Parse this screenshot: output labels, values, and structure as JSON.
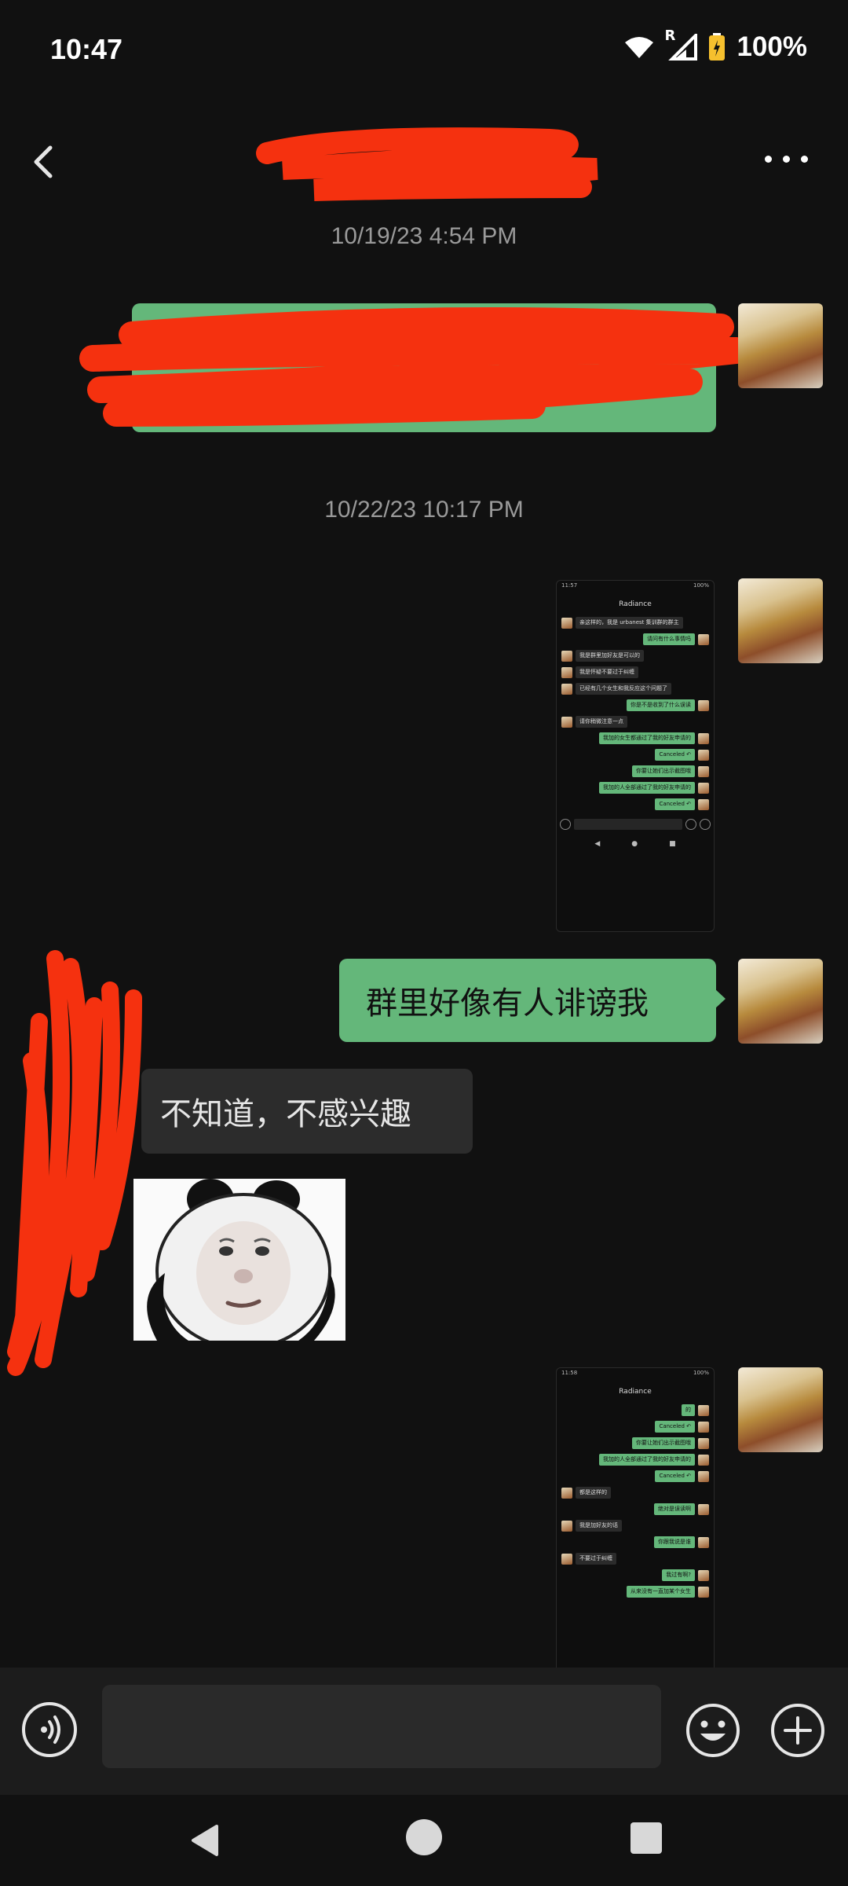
{
  "status_bar": {
    "time": "10:47",
    "signal_label": "R",
    "battery": "100%"
  },
  "header": {
    "back_icon": "chevron-left-icon",
    "more_icon": "more-dots-icon",
    "title_redacted": true
  },
  "messages": [
    {
      "type": "timestamp",
      "text": "10/19/23 4:54 PM"
    },
    {
      "type": "outgoing-text",
      "redacted": true
    },
    {
      "type": "timestamp",
      "text": "10/22/23 10:17 PM"
    },
    {
      "type": "outgoing-image",
      "screenshot": {
        "status_time": "11:57",
        "status_right": "100%",
        "title": "Radiance",
        "rows": [
          {
            "side": "in",
            "text": "亲这样的，我是 urbanest 集训群的群主"
          },
          {
            "side": "out",
            "text": "请问有什么事情吗"
          },
          {
            "side": "in",
            "text": "我是群里加好友是可以的"
          },
          {
            "side": "in",
            "text": "我是怀疑不要过于纠缠"
          },
          {
            "side": "in",
            "text": "已经有几个女生和我反应这个问题了"
          },
          {
            "side": "out",
            "text": "你是不是收到了什么误读"
          },
          {
            "side": "in",
            "text": "请你稍微注意一点"
          },
          {
            "side": "out",
            "text": "我加的女生都通过了我的好友申请的"
          },
          {
            "side": "out",
            "text": "Canceled ↶"
          },
          {
            "side": "out",
            "text": "你要让她们出示截图哦"
          },
          {
            "side": "out",
            "text": "我加的人全部通过了我的好友申请的"
          },
          {
            "side": "out",
            "text": "Canceled ↶"
          }
        ]
      }
    },
    {
      "type": "outgoing-text",
      "text": "群里好像有人诽谤我"
    },
    {
      "type": "incoming-text",
      "text": "不知道，不感兴趣"
    },
    {
      "type": "incoming-sticker",
      "sticker": "panda-face-sticker"
    },
    {
      "type": "outgoing-image",
      "screenshot": {
        "status_time": "11:58",
        "status_right": "100%",
        "title": "Radiance",
        "rows": [
          {
            "side": "out",
            "text": "的"
          },
          {
            "side": "out",
            "text": "Canceled ↶"
          },
          {
            "side": "out",
            "text": "你要让她们出示截图哦"
          },
          {
            "side": "out",
            "text": "我加的人全部通过了我的好友申请的"
          },
          {
            "side": "out",
            "text": "Canceled ↶"
          },
          {
            "side": "in",
            "text": "都是这样的"
          },
          {
            "side": "out",
            "text": "绝对是误读啊"
          },
          {
            "side": "in",
            "text": "我是加好友的话"
          },
          {
            "side": "out",
            "text": "你跟我说是谁"
          },
          {
            "side": "in",
            "text": "不要过于纠缠"
          },
          {
            "side": "out",
            "text": "我过有啊?"
          },
          {
            "side": "out",
            "text": "从来没有一直加某个女生"
          }
        ]
      }
    }
  ],
  "input_bar": {
    "voice_icon": "voice-input-icon",
    "placeholder": "",
    "emoji_icon": "emoji-icon",
    "plus_icon": "add-plus-icon"
  },
  "nav_bar": {
    "back_icon": "nav-back-icon",
    "home_icon": "nav-home-icon",
    "recents_icon": "nav-recents-icon"
  },
  "colors": {
    "background": "#111111",
    "outgoing_bubble": "#64b77a",
    "incoming_bubble": "#2c2c2c",
    "redaction": "#f5310f"
  }
}
